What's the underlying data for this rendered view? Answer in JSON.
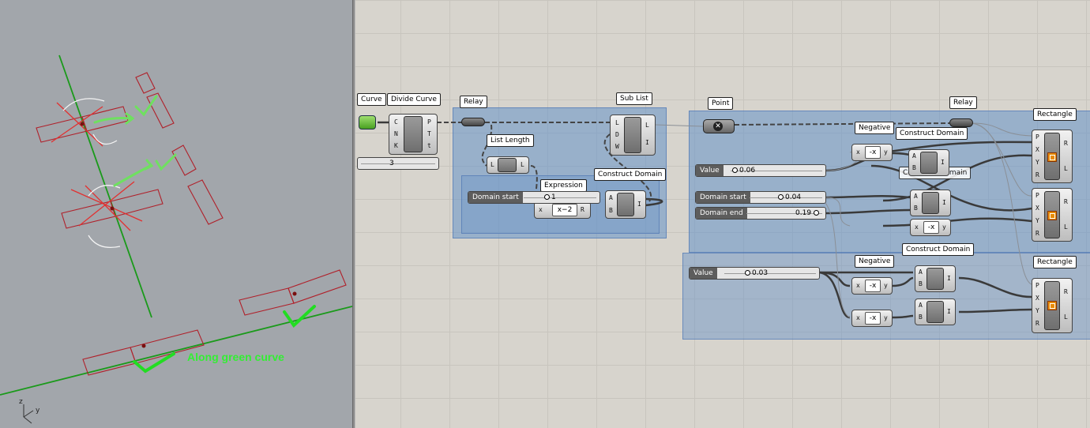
{
  "viewport": {
    "annotation": "Along green curve",
    "axis_y": "y",
    "axis_z": "z"
  },
  "canvas": {
    "components": {
      "curve": {
        "title": "Curve"
      },
      "divide_curve": {
        "title": "Divide Curve",
        "inputs": [
          "C",
          "N",
          "K"
        ],
        "outputs": [
          "P",
          "T",
          "t"
        ]
      },
      "count_slider": {
        "value": "3"
      },
      "relay_1": {
        "title": "Relay"
      },
      "list_length": {
        "title": "List Length",
        "input": "L",
        "output": "L"
      },
      "sub_list": {
        "title": "Sub List",
        "inputs": [
          "L",
          "D",
          "W"
        ],
        "outputs": [
          "L",
          "I"
        ]
      },
      "expression": {
        "title": "Expression",
        "input": "x",
        "formula": "x−2",
        "output": "R"
      },
      "domain_start_1": {
        "label": "Domain start",
        "value": "1"
      },
      "construct_domain_1": {
        "title": "Construct Domain",
        "inputs": [
          "A",
          "B"
        ],
        "output": "I"
      },
      "point": {
        "title": "Point"
      },
      "relay_2": {
        "title": "Relay"
      },
      "negative_1": {
        "title": "Negative",
        "input": "x",
        "output": "y"
      },
      "construct_domain_2": {
        "title": "Construct Domain",
        "inputs": [
          "A",
          "B"
        ],
        "output": "I",
        "under": "Construct Domain"
      },
      "value_1": {
        "label": "Value",
        "value": "0.06"
      },
      "domain_start_2": {
        "label": "Domain start",
        "value": "0.04"
      },
      "domain_end": {
        "label": "Domain end",
        "value": "0.19"
      },
      "negative_2": {
        "input": "x",
        "output": "y"
      },
      "rectangle_1": {
        "title": "Rectangle",
        "inputs": [
          "P",
          "X",
          "Y",
          "R"
        ],
        "outputs": [
          "R",
          "L"
        ]
      },
      "rectangle_2": {
        "inputs": [
          "P",
          "X",
          "Y",
          "R"
        ],
        "outputs": [
          "R",
          "L"
        ]
      },
      "value_2": {
        "label": "Value",
        "value": "0.03"
      },
      "negative_3": {
        "title": "Negative",
        "input": "x",
        "output": "y"
      },
      "construct_domain_3": {
        "title": "Construct Domain",
        "inputs": [
          "A",
          "B"
        ],
        "output": "I"
      },
      "negative_4": {
        "input": "x",
        "output": "y"
      },
      "construct_domain_4": {
        "inputs": [
          "A",
          "B"
        ],
        "output": "I"
      },
      "rectangle_3": {
        "title": "Rectangle",
        "inputs": [
          "P",
          "X",
          "Y",
          "R"
        ],
        "outputs": [
          "R",
          "L"
        ]
      }
    }
  },
  "colors": {
    "viewport_bg": "#a2a6ab",
    "canvas_bg": "#d7d4cd",
    "group_fill": "#6491c8",
    "rhino_geometry": "#b0202a",
    "green_curve": "#1a9a1a",
    "annotation_green": "#33ee33"
  }
}
